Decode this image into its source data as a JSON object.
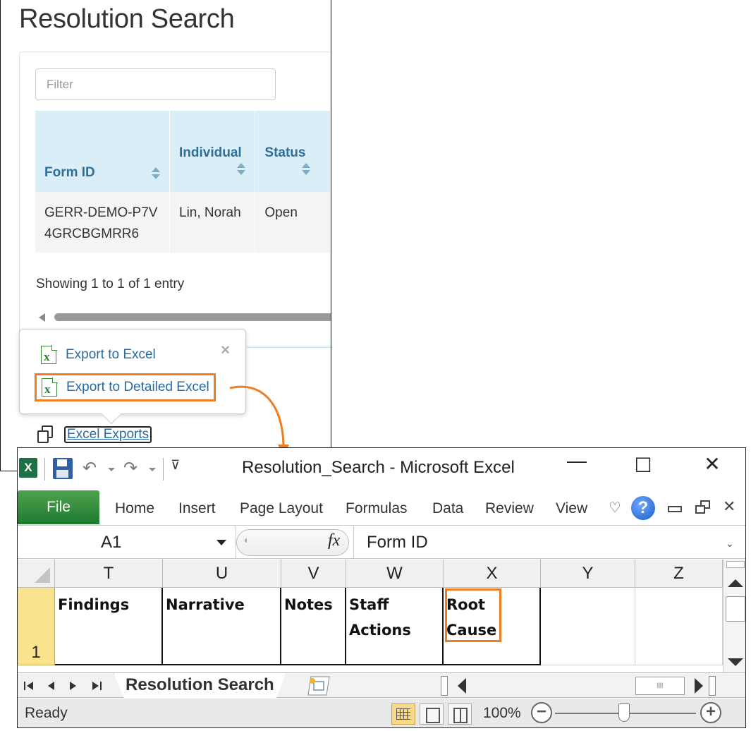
{
  "web": {
    "title": "Resolution Search",
    "filter_placeholder": "Filter",
    "table": {
      "headers": [
        "Form ID",
        "Individual",
        "Status"
      ],
      "rows": [
        [
          "GERR-DEMO-P7V4GRCBGMRR6",
          "Lin, Norah",
          "Open"
        ]
      ]
    },
    "info": "Showing 1 to 1 of 1 entry",
    "popover": {
      "close_label": "×",
      "items": [
        "Export to Excel",
        "Export to Detailed Excel"
      ],
      "icon_glyph": "x"
    },
    "exports_link": "Excel Exports"
  },
  "excel": {
    "title": "Resolution_Search  -  Microsoft Excel",
    "logo_glyph": "X",
    "minimize_glyph": "—",
    "maximize_glyph": "☐",
    "close_glyph": "✕",
    "ribbon_tabs": [
      "File",
      "Home",
      "Insert",
      "Page Layout",
      "Formulas",
      "Data",
      "Review",
      "View"
    ],
    "help_glyph": "?",
    "name_box": "A1",
    "fx": "fx",
    "formula": "Form ID",
    "columns": [
      "T",
      "U",
      "V",
      "W",
      "X",
      "Y",
      "Z"
    ],
    "row_number": "1",
    "cells": [
      "Findings",
      "Narrative",
      "Notes",
      "Staff Actions",
      "Root Cause",
      "",
      ""
    ],
    "sheet_tab": "Resolution Search",
    "status": "Ready",
    "zoom": "100%",
    "zoom_out": "−",
    "zoom_in": "+",
    "hscroll_thumb": "III",
    "accent_color": "#ef7d22",
    "file_tab_color": "#2b8a3e"
  }
}
